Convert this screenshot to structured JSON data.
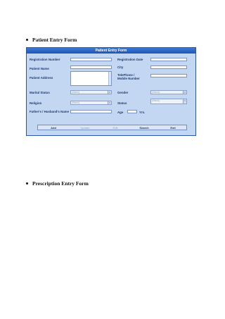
{
  "sections": {
    "first": "Patient Entry Form",
    "second": "Prescription Entry Form"
  },
  "form": {
    "title": "Patient Entry Form",
    "labels": {
      "registration_number": "Registration Number",
      "patient_name": "Patient Name",
      "patient_address": "Patient Address",
      "marital_status": "Marital Status",
      "religion": "Religion",
      "father_husband_name": "Father's / Husband's Name",
      "registration_date": "Registration Date",
      "city": "City",
      "telephone": "TelePhone / Mobile Number",
      "gender": "Gender",
      "status": "Status",
      "age": "Age",
      "yrs": "Yrs."
    },
    "selects": {
      "marital_status": "(Blank)",
      "religion": "(Blank)",
      "gender": "(Blank)",
      "status": "(Blank)"
    },
    "buttons": {
      "add": "Add",
      "update": "Update",
      "edit": "Edit",
      "search": "Search",
      "exit": "Exit"
    }
  }
}
